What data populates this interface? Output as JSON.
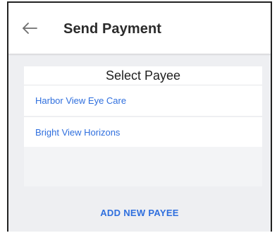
{
  "app_bar": {
    "back_icon": "arrow-left-icon",
    "title": "Send Payment"
  },
  "payee_card": {
    "title": "Select Payee",
    "payees": [
      {
        "label": "Harbor View Eye Care"
      },
      {
        "label": "Bright View Horizons"
      }
    ]
  },
  "actions": {
    "add_payee_label": "ADD NEW PAYEE"
  },
  "colors": {
    "accent": "#2f6fde",
    "background": "#eeeff2",
    "app_bar": "#ffffff"
  }
}
